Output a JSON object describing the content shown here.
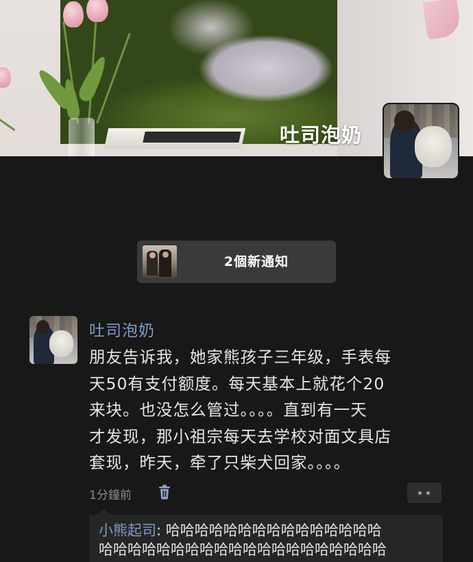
{
  "profile": {
    "cover_name": "吐司泡奶",
    "avatar_icon": "user-avatar-photo"
  },
  "notification": {
    "label": "2個新通知",
    "thumb_icon": "notification-sender-photo"
  },
  "post": {
    "author": "吐司泡奶",
    "lines": [
      "朋友告诉我，她家熊孩子三年级，手表每",
      "天50有支付额度。每天基本上就花个20",
      "来块。也没怎么管过。。。。直到有一天",
      "才发现，那小祖宗每天去学校对面文具店",
      "套现，昨天，牵了只柴犬回家。。。。"
    ],
    "time": "1分鐘前",
    "delete_icon": "trash-icon",
    "more_icon": "more-dots-icon"
  },
  "comments": [
    {
      "author": "小熊起司",
      "separator": ": ",
      "text_line1": "哈哈哈哈哈哈哈哈哈哈哈哈哈哈哈",
      "text_line2": "哈哈哈哈哈哈哈哈哈哈哈哈哈哈哈哈哈哈哈哈"
    }
  ],
  "colors": {
    "background": "#181818",
    "link_blue": "#7f9bc9",
    "text": "#e6e6e6",
    "muted": "#8a8a8a",
    "pill": "#3a3a3a"
  }
}
